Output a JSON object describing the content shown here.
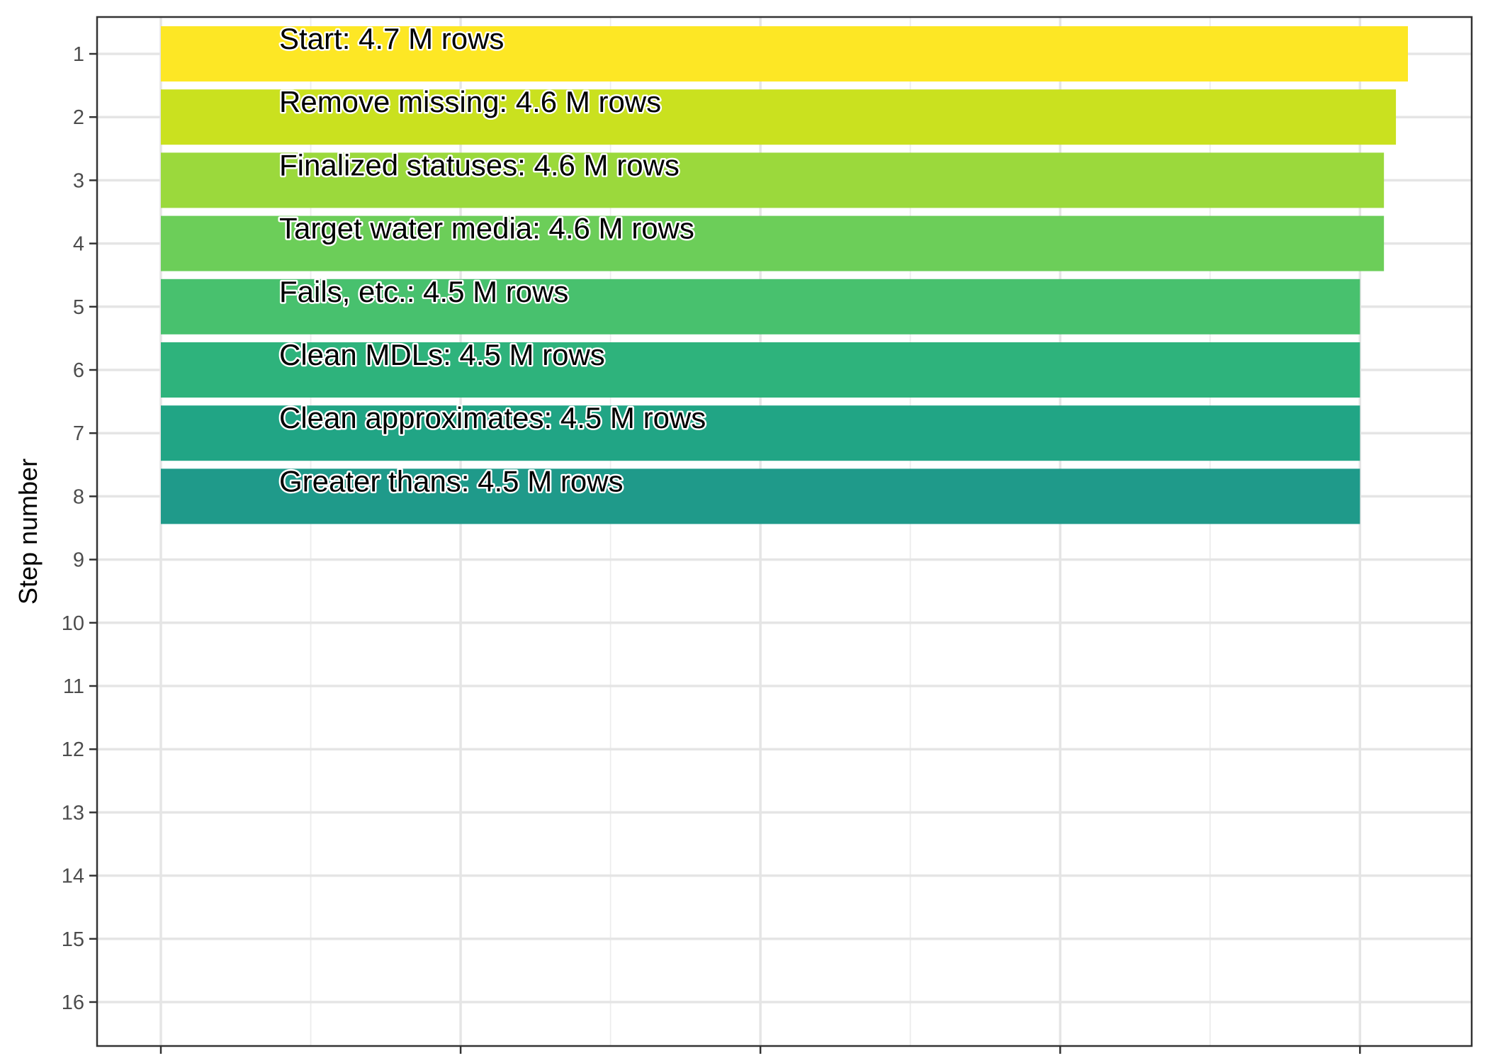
{
  "chart_data": {
    "type": "bar",
    "orientation": "horizontal",
    "ylabel": "Step number",
    "xlabel": "",
    "y_ticks": [
      1,
      2,
      3,
      4,
      5,
      6,
      7,
      8,
      9,
      10,
      11,
      12,
      13,
      14,
      15,
      16
    ],
    "ylim": [
      0.5,
      16.5
    ],
    "xlim": [
      0,
      5.2
    ],
    "x_ticks": [
      0,
      1.25,
      2.5,
      3.75,
      5.0
    ],
    "grid": true,
    "series": [
      {
        "categories": [
          1,
          2,
          3,
          4,
          5,
          6,
          7,
          8
        ],
        "values": [
          5.2,
          5.15,
          5.1,
          5.1,
          5.0,
          5.0,
          5.0,
          5.0
        ],
        "labels": [
          "Start:  4.7 M rows",
          "Remove missing:  4.6 M rows",
          "Finalized statuses:  4.6 M rows",
          "Target water media:  4.6 M rows",
          "Fails, etc.:  4.5 M rows",
          "Clean MDLs:  4.5 M rows",
          "Clean approximates:  4.5 M rows",
          "Greater thans:  4.5 M rows"
        ],
        "colors": [
          "#FDE725",
          "#CAE11F",
          "#9BD93C",
          "#6CCE59",
          "#48C16E",
          "#2EB37C",
          "#21A585",
          "#1F9A8A"
        ]
      }
    ]
  }
}
